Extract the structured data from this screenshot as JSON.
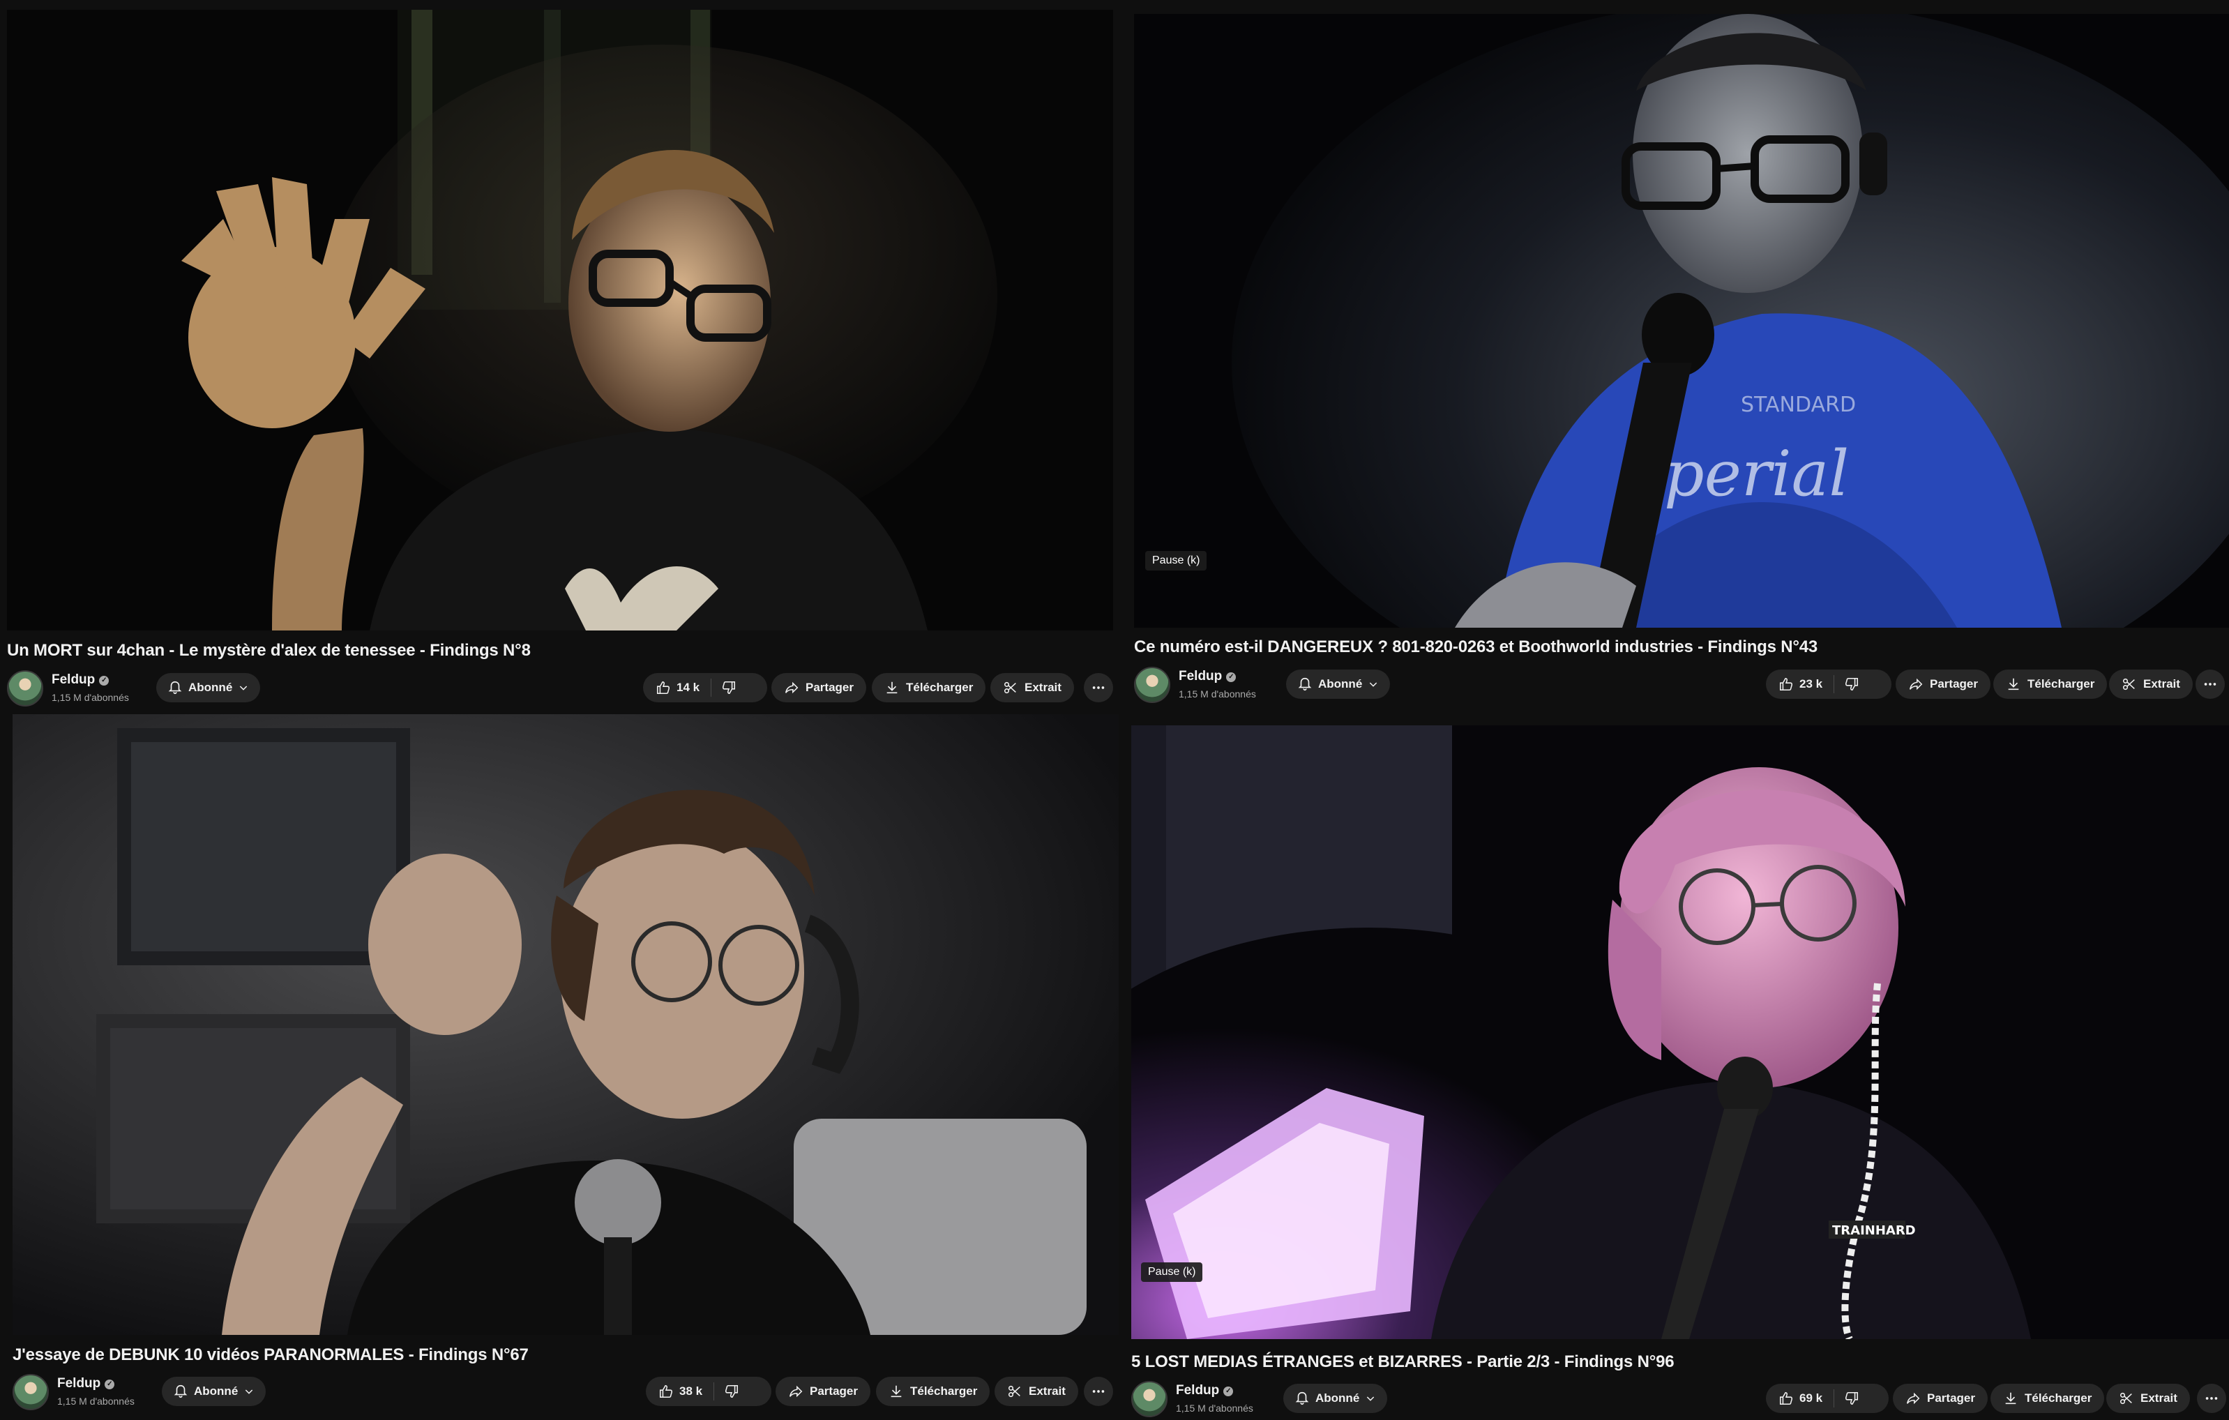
{
  "panels": [
    {
      "title": "Un MORT sur 4chan - Le mystère d'alex de tenessee - Findings N°8",
      "channel": "Feldup",
      "subscribers": "1,15 M d'abonnés",
      "subscribe_label": "Abonné",
      "likes": "14 k",
      "share_label": "Partager",
      "download_label": "Télécharger",
      "clip_label": "Extrait",
      "pause_tip": ""
    },
    {
      "title": "Ce numéro est-il DANGEREUX ? 801-820-0263 et Boothworld industries - Findings N°43",
      "channel": "Feldup",
      "subscribers": "1,15 M d'abonnés",
      "subscribe_label": "Abonné",
      "likes": "23 k",
      "share_label": "Partager",
      "download_label": "Télécharger",
      "clip_label": "Extrait",
      "pause_tip": "Pause (k)"
    },
    {
      "title": "J'essaye de DEBUNK 10 vidéos PARANORMALES - Findings N°67",
      "channel": "Feldup",
      "subscribers": "1,15 M d'abonnés",
      "subscribe_label": "Abonné",
      "likes": "38 k",
      "share_label": "Partager",
      "download_label": "Télécharger",
      "clip_label": "Extrait",
      "pause_tip": ""
    },
    {
      "title": "5 LOST MEDIAS ÉTRANGES et BIZARRES - Partie 2/3 - Findings N°96",
      "channel": "Feldup",
      "subscribers": "1,15 M d'abonnés",
      "subscribe_label": "Abonné",
      "likes": "69 k",
      "share_label": "Partager",
      "download_label": "Télécharger",
      "clip_label": "Extrait",
      "pause_tip": "Pause (k)"
    }
  ],
  "colors": {
    "page_bg": "#0f0f0f",
    "pill_bg": "#272727",
    "text_primary": "#f1f1f1",
    "text_secondary": "#aaaaaa",
    "frame2_hoodie": "#2848b8",
    "frame4_light": "#d26cf0"
  },
  "icons": [
    "verified-icon",
    "bell-icon",
    "chevron-down-icon",
    "thumbs-up-icon",
    "thumbs-down-icon",
    "share-icon",
    "download-icon",
    "scissors-icon",
    "more-icon"
  ]
}
